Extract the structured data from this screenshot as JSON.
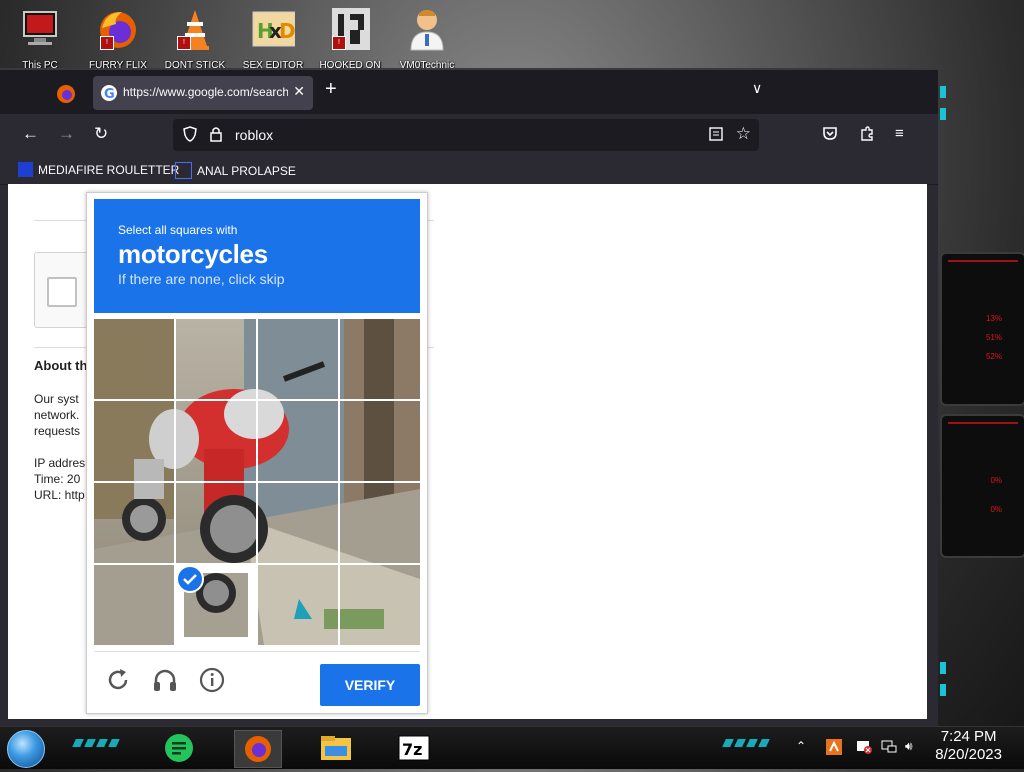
{
  "desktop": {
    "icons": [
      {
        "name": "this-pc",
        "label": "This PC"
      },
      {
        "name": "furry-flix",
        "label": "FURRY FLIX"
      },
      {
        "name": "dont-stick",
        "label": "DONT STICK"
      },
      {
        "name": "sex-editor",
        "label": "SEX EDITOR"
      },
      {
        "name": "hooked-on",
        "label": "HOOKED ON"
      },
      {
        "name": "vm0technic",
        "label": "VM0Technic"
      }
    ],
    "gauges": [
      "13%",
      "51%",
      "52%",
      "0%",
      "0%"
    ]
  },
  "browser": {
    "tab_active_title": "https://www.google.com/search",
    "url_value": "roblox",
    "bookmarks": [
      "MEDIAFIRE ROULETTER",
      "ANAL PROLAPSE"
    ]
  },
  "background_page": {
    "heading": "About th",
    "lines": [
      "Our syst",
      "network.",
      "requests"
    ],
    "info": [
      "IP addres",
      "Time: 20",
      "URL: http"
    ]
  },
  "captcha": {
    "instruction": "Select all squares with",
    "target": "motorcycles",
    "hint": "If there are none, click skip",
    "verify_label": "VERIFY",
    "selected_tiles": [
      13
    ]
  },
  "taskbar": {
    "time": "7:24 PM",
    "date": "8/20/2023"
  },
  "colors": {
    "accent": "#1a73e8",
    "cyan_deco": "#19c4d6",
    "red_deco": "#e01515"
  }
}
